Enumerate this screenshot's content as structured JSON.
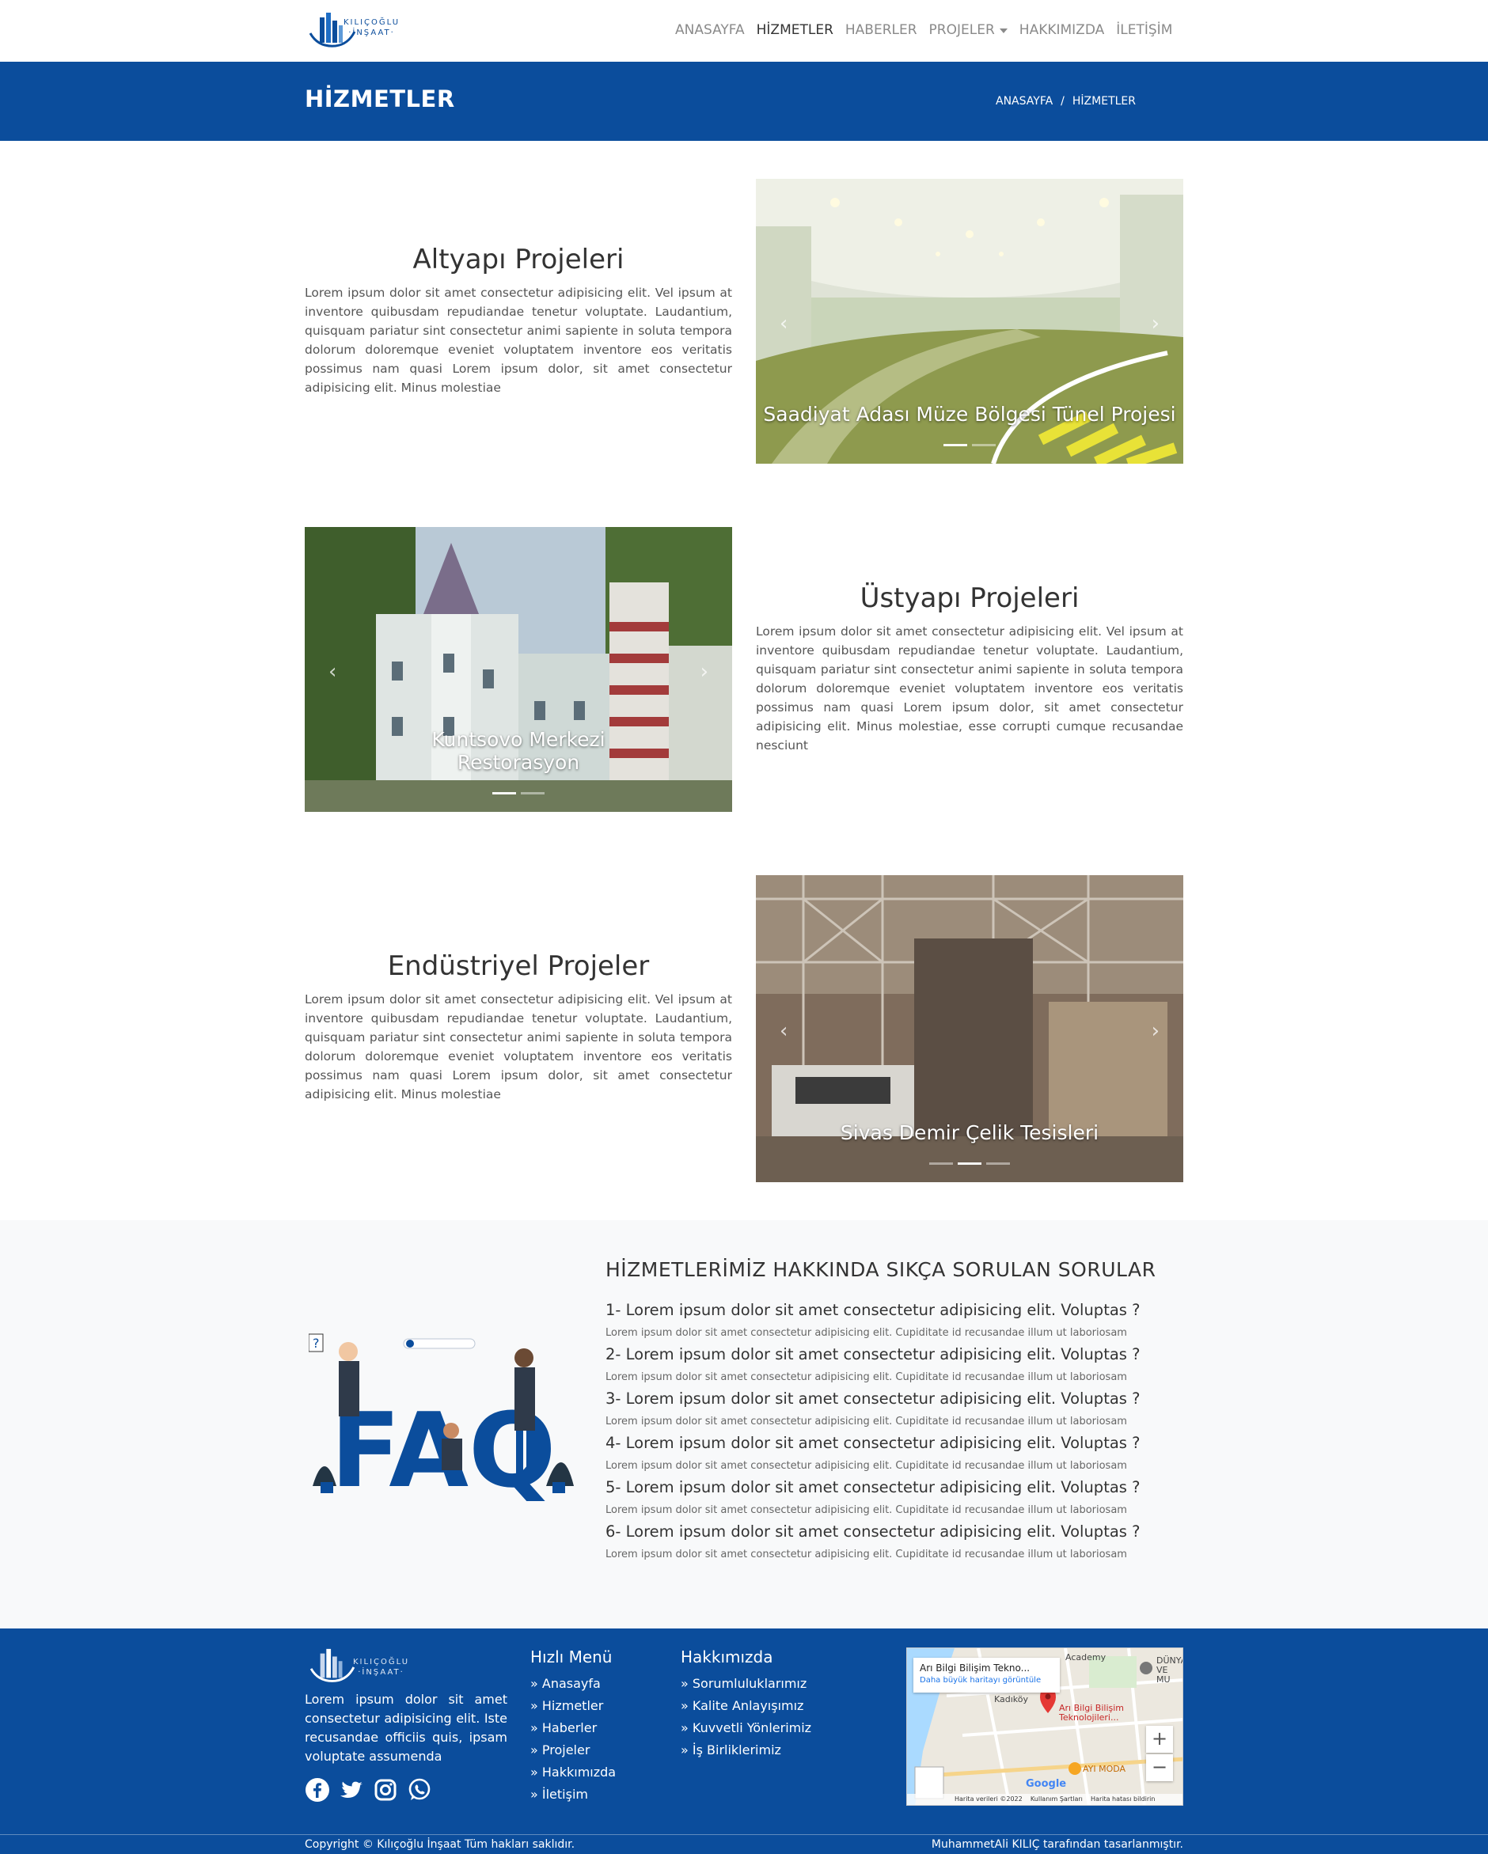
{
  "brand": {
    "name_line1": "KILIÇOĞLU",
    "name_line2": "·İNŞAAT·",
    "color": "#0b4d9c"
  },
  "nav": {
    "items": [
      {
        "label": "ANASAYFA"
      },
      {
        "label": "HİZMETLER"
      },
      {
        "label": "HABERLER"
      },
      {
        "label": "PROJELER"
      },
      {
        "label": "HAKKIMIZDA"
      },
      {
        "label": "İLETİŞİM"
      }
    ],
    "active": "HİZMETLER"
  },
  "banner": {
    "title": "HİZMETLER",
    "breadcrumb": {
      "home": "ANASAYFA",
      "separator": "/",
      "current": "HİZMETLER"
    }
  },
  "services": [
    {
      "title": "Altyapı Projeleri",
      "description": "Lorem ipsum dolor sit amet consectetur adipisicing elit. Vel ipsum at inventore quibusdam repudiandae tenetur voluptate. Laudantium, quisquam pariatur sint consectetur animi sapiente in soluta tempora dolorum doloremque eveniet voluptatem inventore eos veritatis possimus nam quasi Lorem ipsum dolor, sit amet consectetur adipisicing elit. Minus molestiae",
      "caption": "Saadiyat Adası Müze Bölgesi Tünel Projesi"
    },
    {
      "title": "Üstyapı Projeleri",
      "description": "Lorem ipsum dolor sit amet consectetur adipisicing elit. Vel ipsum at inventore quibusdam repudiandae tenetur voluptate. Laudantium, quisquam pariatur sint consectetur animi sapiente in soluta tempora dolorum doloremque eveniet voluptatem inventore eos veritatis possimus nam quasi Lorem ipsum dolor, sit amet consectetur adipisicing elit. Minus molestiae, esse corrupti cumque recusandae nesciunt",
      "caption": "Kuntsovo Merkezi Restorasyon"
    },
    {
      "title": "Endüstriyel Projeler",
      "description": "Lorem ipsum dolor sit amet consectetur adipisicing elit. Vel ipsum at inventore quibusdam repudiandae tenetur voluptate. Laudantium, quisquam pariatur sint consectetur animi sapiente in soluta tempora dolorum doloremque eveniet voluptatem inventore eos veritatis possimus nam quasi Lorem ipsum dolor, sit amet consectetur adipisicing elit. Minus molestiae",
      "caption": "Sivas Demir Çelik Tesisleri"
    }
  ],
  "faq": {
    "heading": "HİZMETLERİMİZ HAKKINDA SIKÇA SORULAN SORULAR",
    "illustration_word": "FAQ",
    "items": [
      {
        "q": "1- Lorem ipsum dolor sit amet consectetur adipisicing elit. Voluptas ?",
        "a": "Lorem ipsum dolor sit amet consectetur adipisicing elit. Cupiditate id recusandae illum ut laboriosam"
      },
      {
        "q": "2- Lorem ipsum dolor sit amet consectetur adipisicing elit. Voluptas ?",
        "a": "Lorem ipsum dolor sit amet consectetur adipisicing elit. Cupiditate id recusandae illum ut laboriosam"
      },
      {
        "q": "3- Lorem ipsum dolor sit amet consectetur adipisicing elit. Voluptas ?",
        "a": "Lorem ipsum dolor sit amet consectetur adipisicing elit. Cupiditate id recusandae illum ut laboriosam"
      },
      {
        "q": "4- Lorem ipsum dolor sit amet consectetur adipisicing elit. Voluptas ?",
        "a": "Lorem ipsum dolor sit amet consectetur adipisicing elit. Cupiditate id recusandae illum ut laboriosam"
      },
      {
        "q": "5- Lorem ipsum dolor sit amet consectetur adipisicing elit. Voluptas ?",
        "a": "Lorem ipsum dolor sit amet consectetur adipisicing elit. Cupiditate id recusandae illum ut laboriosam"
      },
      {
        "q": "6- Lorem ipsum dolor sit amet consectetur adipisicing elit. Voluptas ?",
        "a": "Lorem ipsum dolor sit amet consectetur adipisicing elit. Cupiditate id recusandae illum ut laboriosam"
      }
    ]
  },
  "footer": {
    "description": "Lorem ipsum dolor sit amet consectetur adipisicing elit. Iste recusandae officiis quis, ipsam voluptate assumenda",
    "social_icons": [
      "facebook-icon",
      "twitter-icon",
      "instagram-icon",
      "whatsapp-icon"
    ],
    "quick_menu": {
      "title": "Hızlı Menü",
      "links": [
        "» Anasayfa",
        "» Hizmetler",
        "» Haberler",
        "» Projeler",
        "» Hakkımızda",
        "» İletişim"
      ]
    },
    "about": {
      "title": "Hakkımızda",
      "links": [
        "» Sorumluluklarımız",
        "» Kalite Anlayışımız",
        "» Kuvvetli Yönlerimiz",
        "» İş Birliklerimiz"
      ]
    },
    "map": {
      "card_title": "Arı Bilgi Bilişim Tekno...",
      "card_link": "Daha büyük haritayı görüntüle",
      "pin_label": "Arı Bilgi Bilişim Teknolojileri...",
      "labels": [
        "Academy",
        "Kadıköy",
        "AYI MODA",
        "DÜNYA VE MU"
      ],
      "zoom_in": "+",
      "zoom_out": "−",
      "google": "Google",
      "footer_data": "Harita verileri ©2022",
      "footer_terms": "Kullanım Şartları",
      "footer_report": "Harita hatası bildirin"
    },
    "copyright": "Copyright © Kılıçoğlu İnşaat Tüm hakları saklıdır.",
    "designer": "MuhammetAli KILIÇ tarafından tasarlanmıştır."
  }
}
